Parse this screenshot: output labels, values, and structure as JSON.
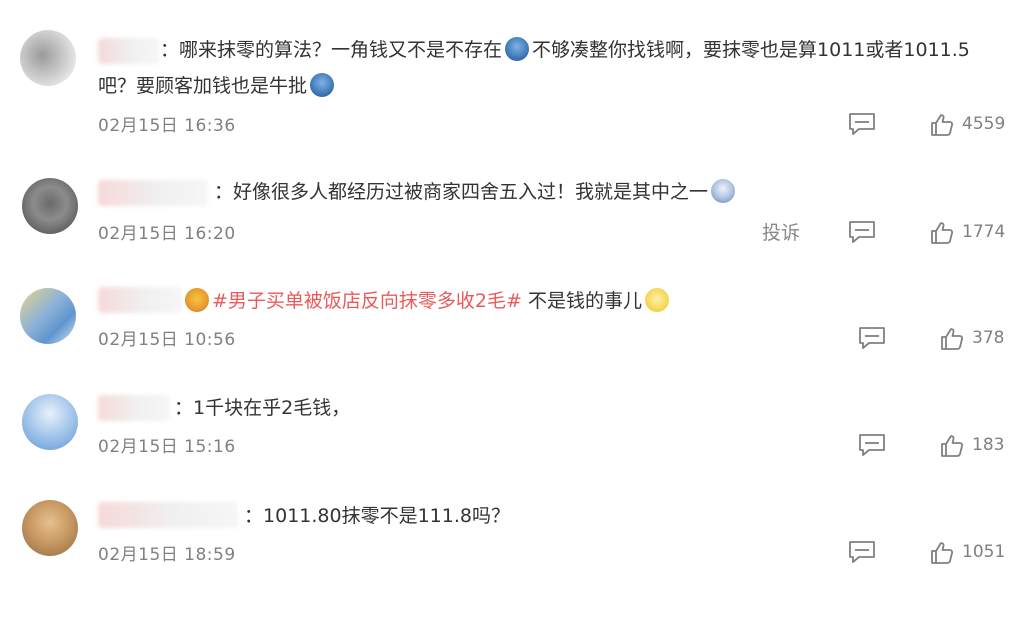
{
  "comments": [
    {
      "colon": "：",
      "text1": "哪来抹零的算法？一角钱又不是不存在",
      "text2": "不够凑整你找钱啊，要抹零也是算1011或者1011.5",
      "text3": "吧？要顾客加钱也是牛批",
      "time": "02月15日 16:36",
      "likes": "4559"
    },
    {
      "colon": "：",
      "text1": "好像很多人都经历过被商家四舍五入过！我就是其中之一",
      "time": "02月15日 16:20",
      "report": "投诉",
      "likes": "1774"
    },
    {
      "hashtag": "#男子买单被饭店反向抹零多收2毛#",
      "text1": " 不是钱的事儿",
      "time": "02月15日 10:56",
      "likes": "378"
    },
    {
      "colon": "：",
      "text1": "1千块在乎2毛钱，",
      "time": "02月15日 15:16",
      "likes": "183"
    },
    {
      "colon": "：",
      "text1": "1011.80抹零不是111.8吗？",
      "time": "02月15日 18:59",
      "likes": "1051"
    }
  ],
  "colors": {
    "hashtag": "#eb5a5a",
    "meta": "#808080",
    "text": "#333333"
  },
  "icons": [
    "reply-icon",
    "thumbs-up-icon",
    "emoji-icon"
  ]
}
